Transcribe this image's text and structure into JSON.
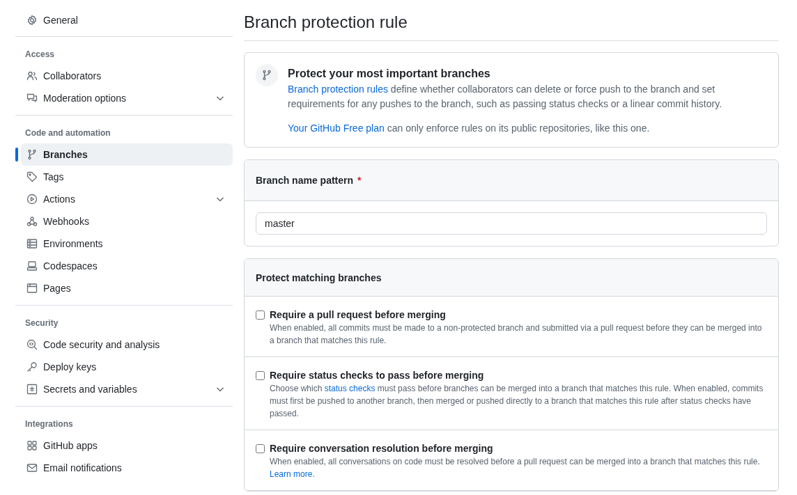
{
  "sidebar": {
    "groups": [
      {
        "items": [
          {
            "label": "General",
            "selected": false,
            "expandable": false
          }
        ]
      },
      {
        "heading": "Access",
        "items": [
          {
            "label": "Collaborators",
            "selected": false,
            "expandable": false
          },
          {
            "label": "Moderation options",
            "selected": false,
            "expandable": true
          }
        ]
      },
      {
        "heading": "Code and automation",
        "items": [
          {
            "label": "Branches",
            "selected": true,
            "expandable": false
          },
          {
            "label": "Tags",
            "selected": false,
            "expandable": false
          },
          {
            "label": "Actions",
            "selected": false,
            "expandable": true
          },
          {
            "label": "Webhooks",
            "selected": false,
            "expandable": false
          },
          {
            "label": "Environments",
            "selected": false,
            "expandable": false
          },
          {
            "label": "Codespaces",
            "selected": false,
            "expandable": false
          },
          {
            "label": "Pages",
            "selected": false,
            "expandable": false
          }
        ]
      },
      {
        "heading": "Security",
        "items": [
          {
            "label": "Code security and analysis",
            "selected": false,
            "expandable": false
          },
          {
            "label": "Deploy keys",
            "selected": false,
            "expandable": false
          },
          {
            "label": "Secrets and variables",
            "selected": false,
            "expandable": true
          }
        ]
      },
      {
        "heading": "Integrations",
        "items": [
          {
            "label": "GitHub apps",
            "selected": false,
            "expandable": false
          },
          {
            "label": "Email notifications",
            "selected": false,
            "expandable": false
          }
        ]
      }
    ]
  },
  "page_title": "Branch protection rule",
  "intro": {
    "title": "Protect your most important branches",
    "paragraphs": [
      {
        "link": "Branch protection rules",
        "after": " define whether collaborators can delete or force push to the branch and set requirements for any pushes to the branch, such as passing status checks or a linear commit history."
      },
      {
        "link": "Your GitHub Free plan",
        "after": " can only enforce rules on its public repositories, like this one."
      }
    ]
  },
  "pattern": {
    "label": "Branch name pattern",
    "required_mark": "*",
    "value": "master"
  },
  "protect": {
    "heading": "Protect matching branches",
    "rules": [
      {
        "title": "Require a pull request before merging",
        "checked": false,
        "before": "When enabled, all commits must be made to a non-protected branch and submitted via a pull request before they can be merged into a branch that matches this rule."
      },
      {
        "title": "Require status checks to pass before merging",
        "checked": false,
        "before": "Choose which ",
        "link": "status checks",
        "after": " must pass before branches can be merged into a branch that matches this rule. When enabled, commits must first be pushed to another branch, then merged or pushed directly to a branch that matches this rule after status checks have passed."
      },
      {
        "title": "Require conversation resolution before merging",
        "checked": false,
        "before": "When enabled, all conversations on code must be resolved before a pull request can be merged into a branch that matches this rule. ",
        "link": "Learn more",
        "after": "."
      }
    ]
  }
}
